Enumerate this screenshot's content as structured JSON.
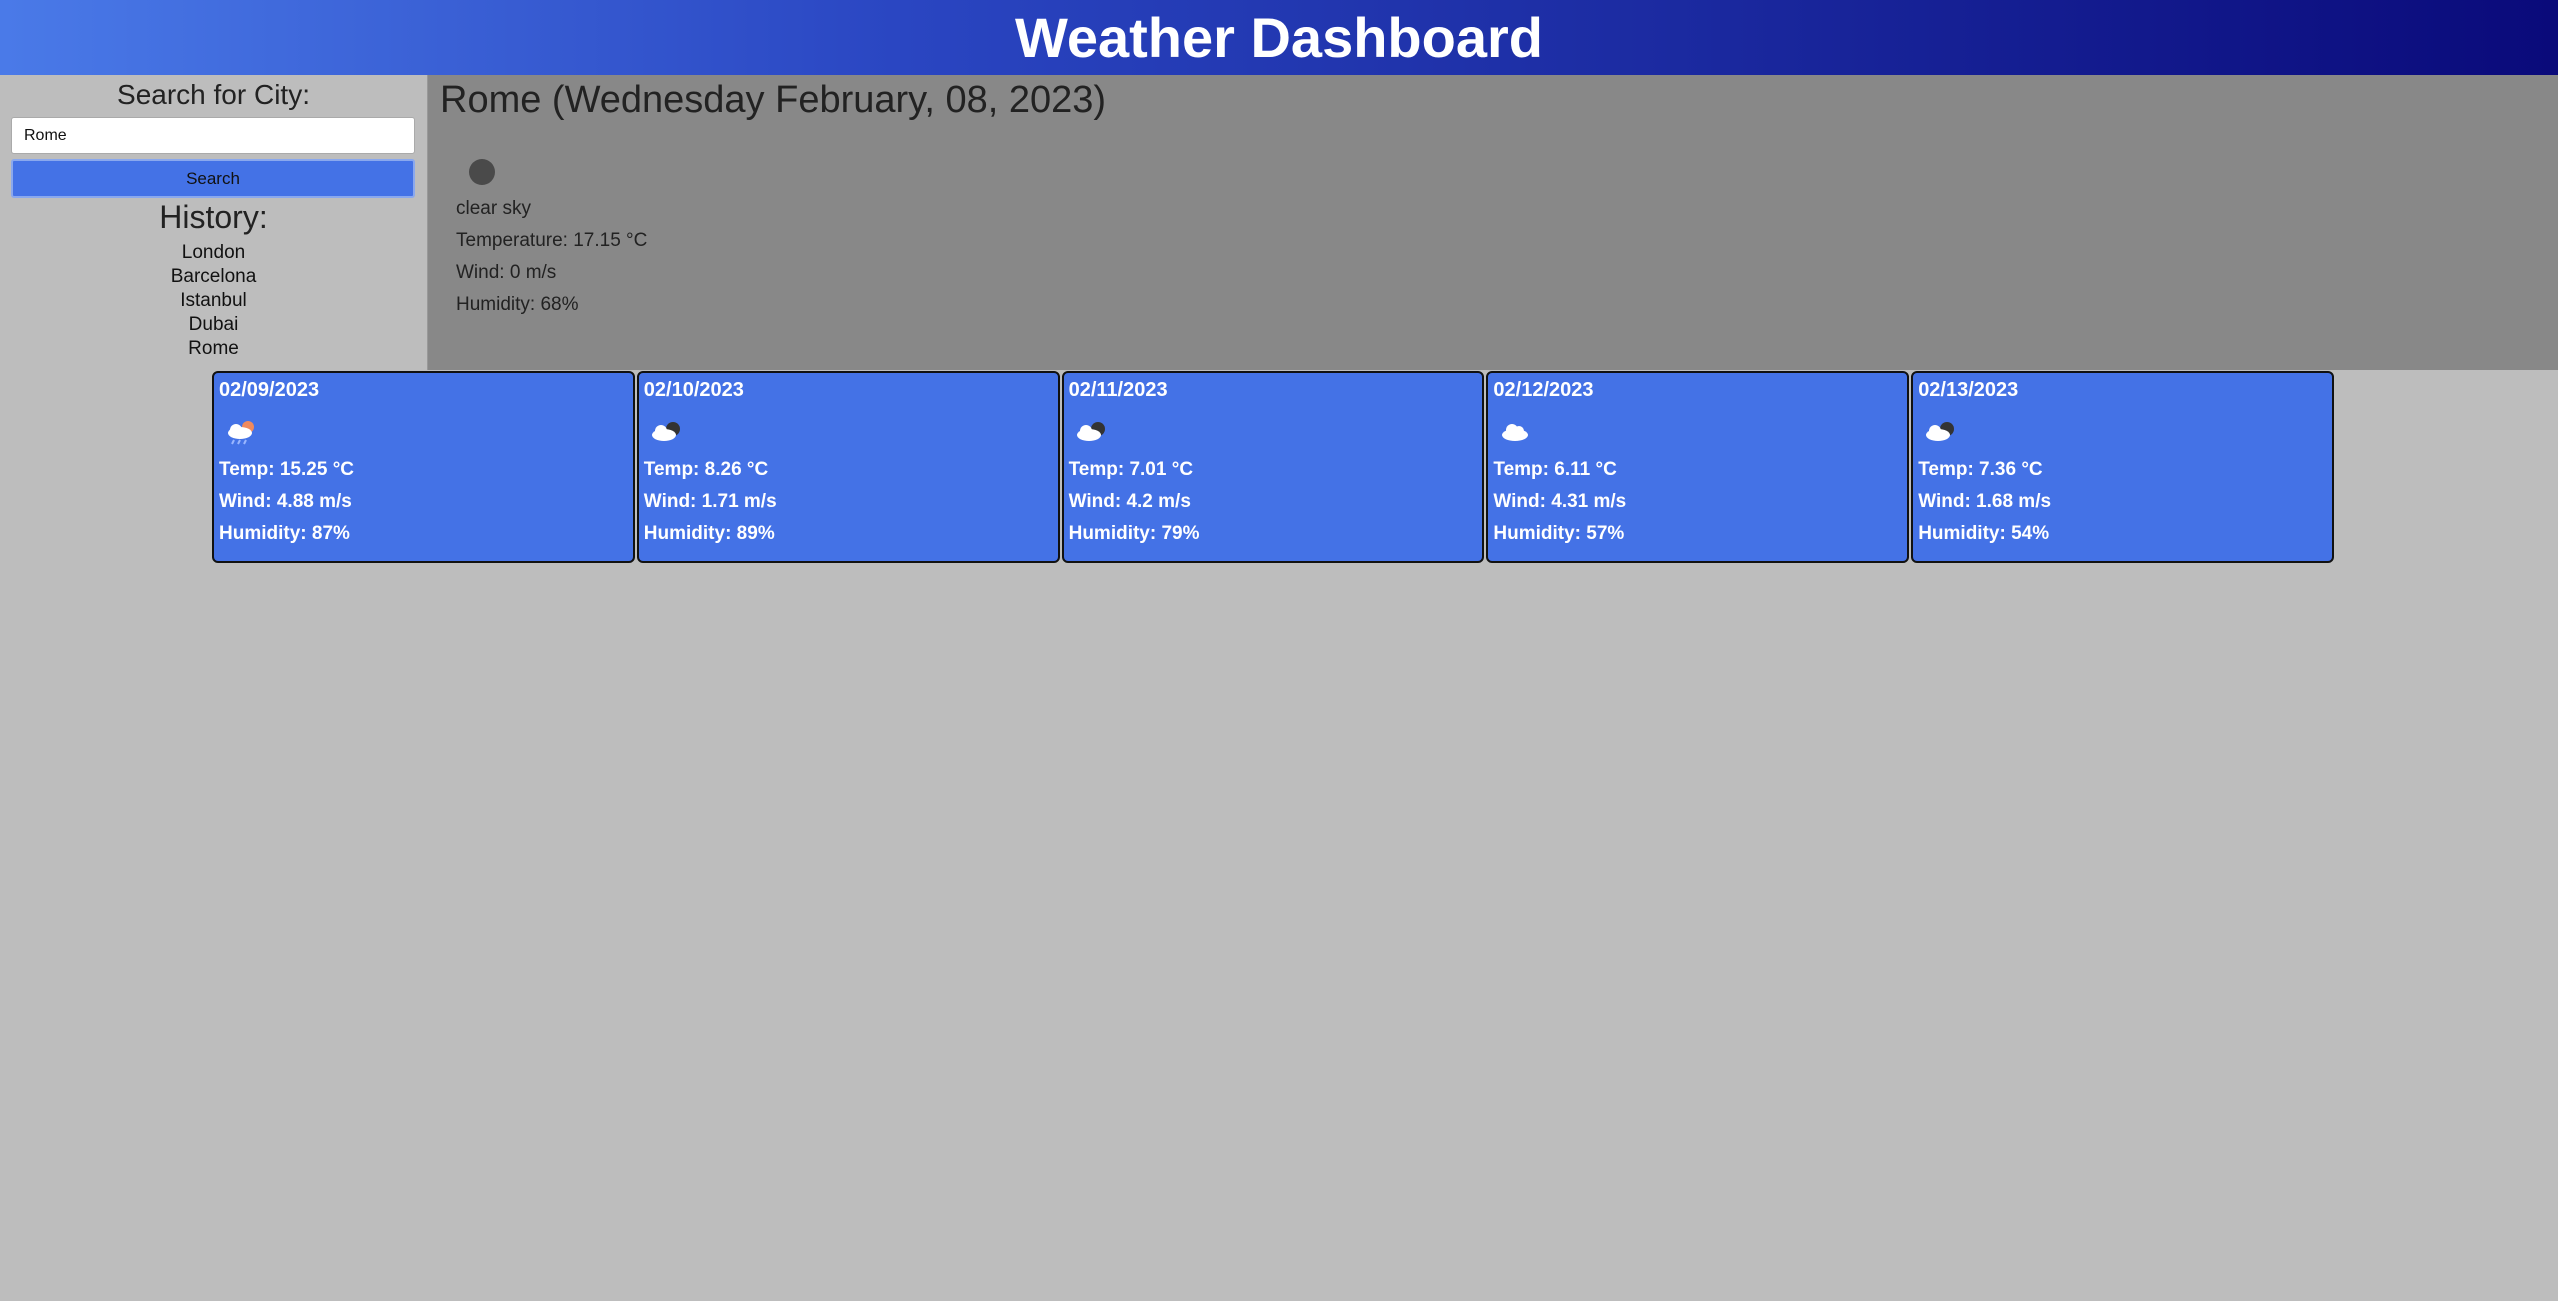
{
  "header": {
    "title": "Weather Dashboard"
  },
  "sidebar": {
    "search_label": "Search for City:",
    "search_value": "Rome",
    "search_button": "Search",
    "history_title": "History:",
    "history": [
      "London",
      "Barcelona",
      "Istanbul",
      "Dubai",
      "Rome"
    ]
  },
  "current": {
    "title": "Rome (Wednesday February, 08, 2023)",
    "icon": "clear-sky-icon",
    "description": "clear sky",
    "temperature": "Temperature: 17.15 °C",
    "wind": "Wind: 0 m/s",
    "humidity": "Humidity: 68%"
  },
  "forecast": [
    {
      "date": "02/09/2023",
      "icon": "cloud-rain-icon",
      "temp": "Temp: 15.25 °C",
      "wind": "Wind: 4.88 m/s",
      "humidity": "Humidity: 87%"
    },
    {
      "date": "02/10/2023",
      "icon": "cloud-moon-icon",
      "temp": "Temp: 8.26 °C",
      "wind": "Wind: 1.71 m/s",
      "humidity": "Humidity: 89%"
    },
    {
      "date": "02/11/2023",
      "icon": "cloud-moon-icon",
      "temp": "Temp: 7.01 °C",
      "wind": "Wind: 4.2 m/s",
      "humidity": "Humidity: 79%"
    },
    {
      "date": "02/12/2023",
      "icon": "cloud-icon",
      "temp": "Temp: 6.11 °C",
      "wind": "Wind: 4.31 m/s",
      "humidity": "Humidity: 57%"
    },
    {
      "date": "02/13/2023",
      "icon": "cloud-moon-icon",
      "temp": "Temp: 7.36 °C",
      "wind": "Wind: 1.68 m/s",
      "humidity": "Humidity: 54%"
    }
  ],
  "colors": {
    "accent": "#4472e6",
    "page_background": "#bdbdbd",
    "current_background": "#888888"
  }
}
